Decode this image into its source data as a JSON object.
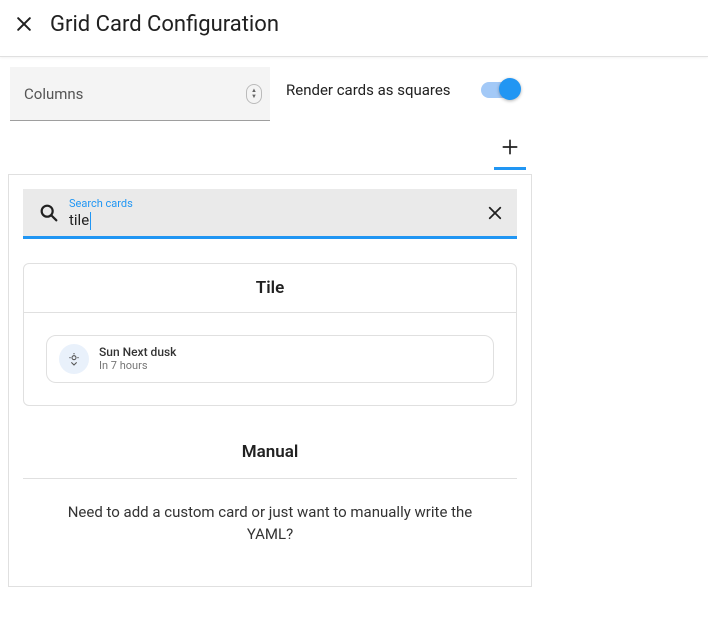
{
  "header": {
    "title": "Grid Card Configuration"
  },
  "fields": {
    "columns_label": "Columns",
    "render_squares_label": "Render cards as squares",
    "render_squares_on": true
  },
  "search": {
    "float_label": "Search cards",
    "value": "tile"
  },
  "results": {
    "section_title": "Tile",
    "tile": {
      "name": "Sun Next dusk",
      "subtitle": "In 7 hours"
    }
  },
  "manual": {
    "title": "Manual",
    "text": "Need to add a custom card or just want to manually write the YAML?"
  }
}
